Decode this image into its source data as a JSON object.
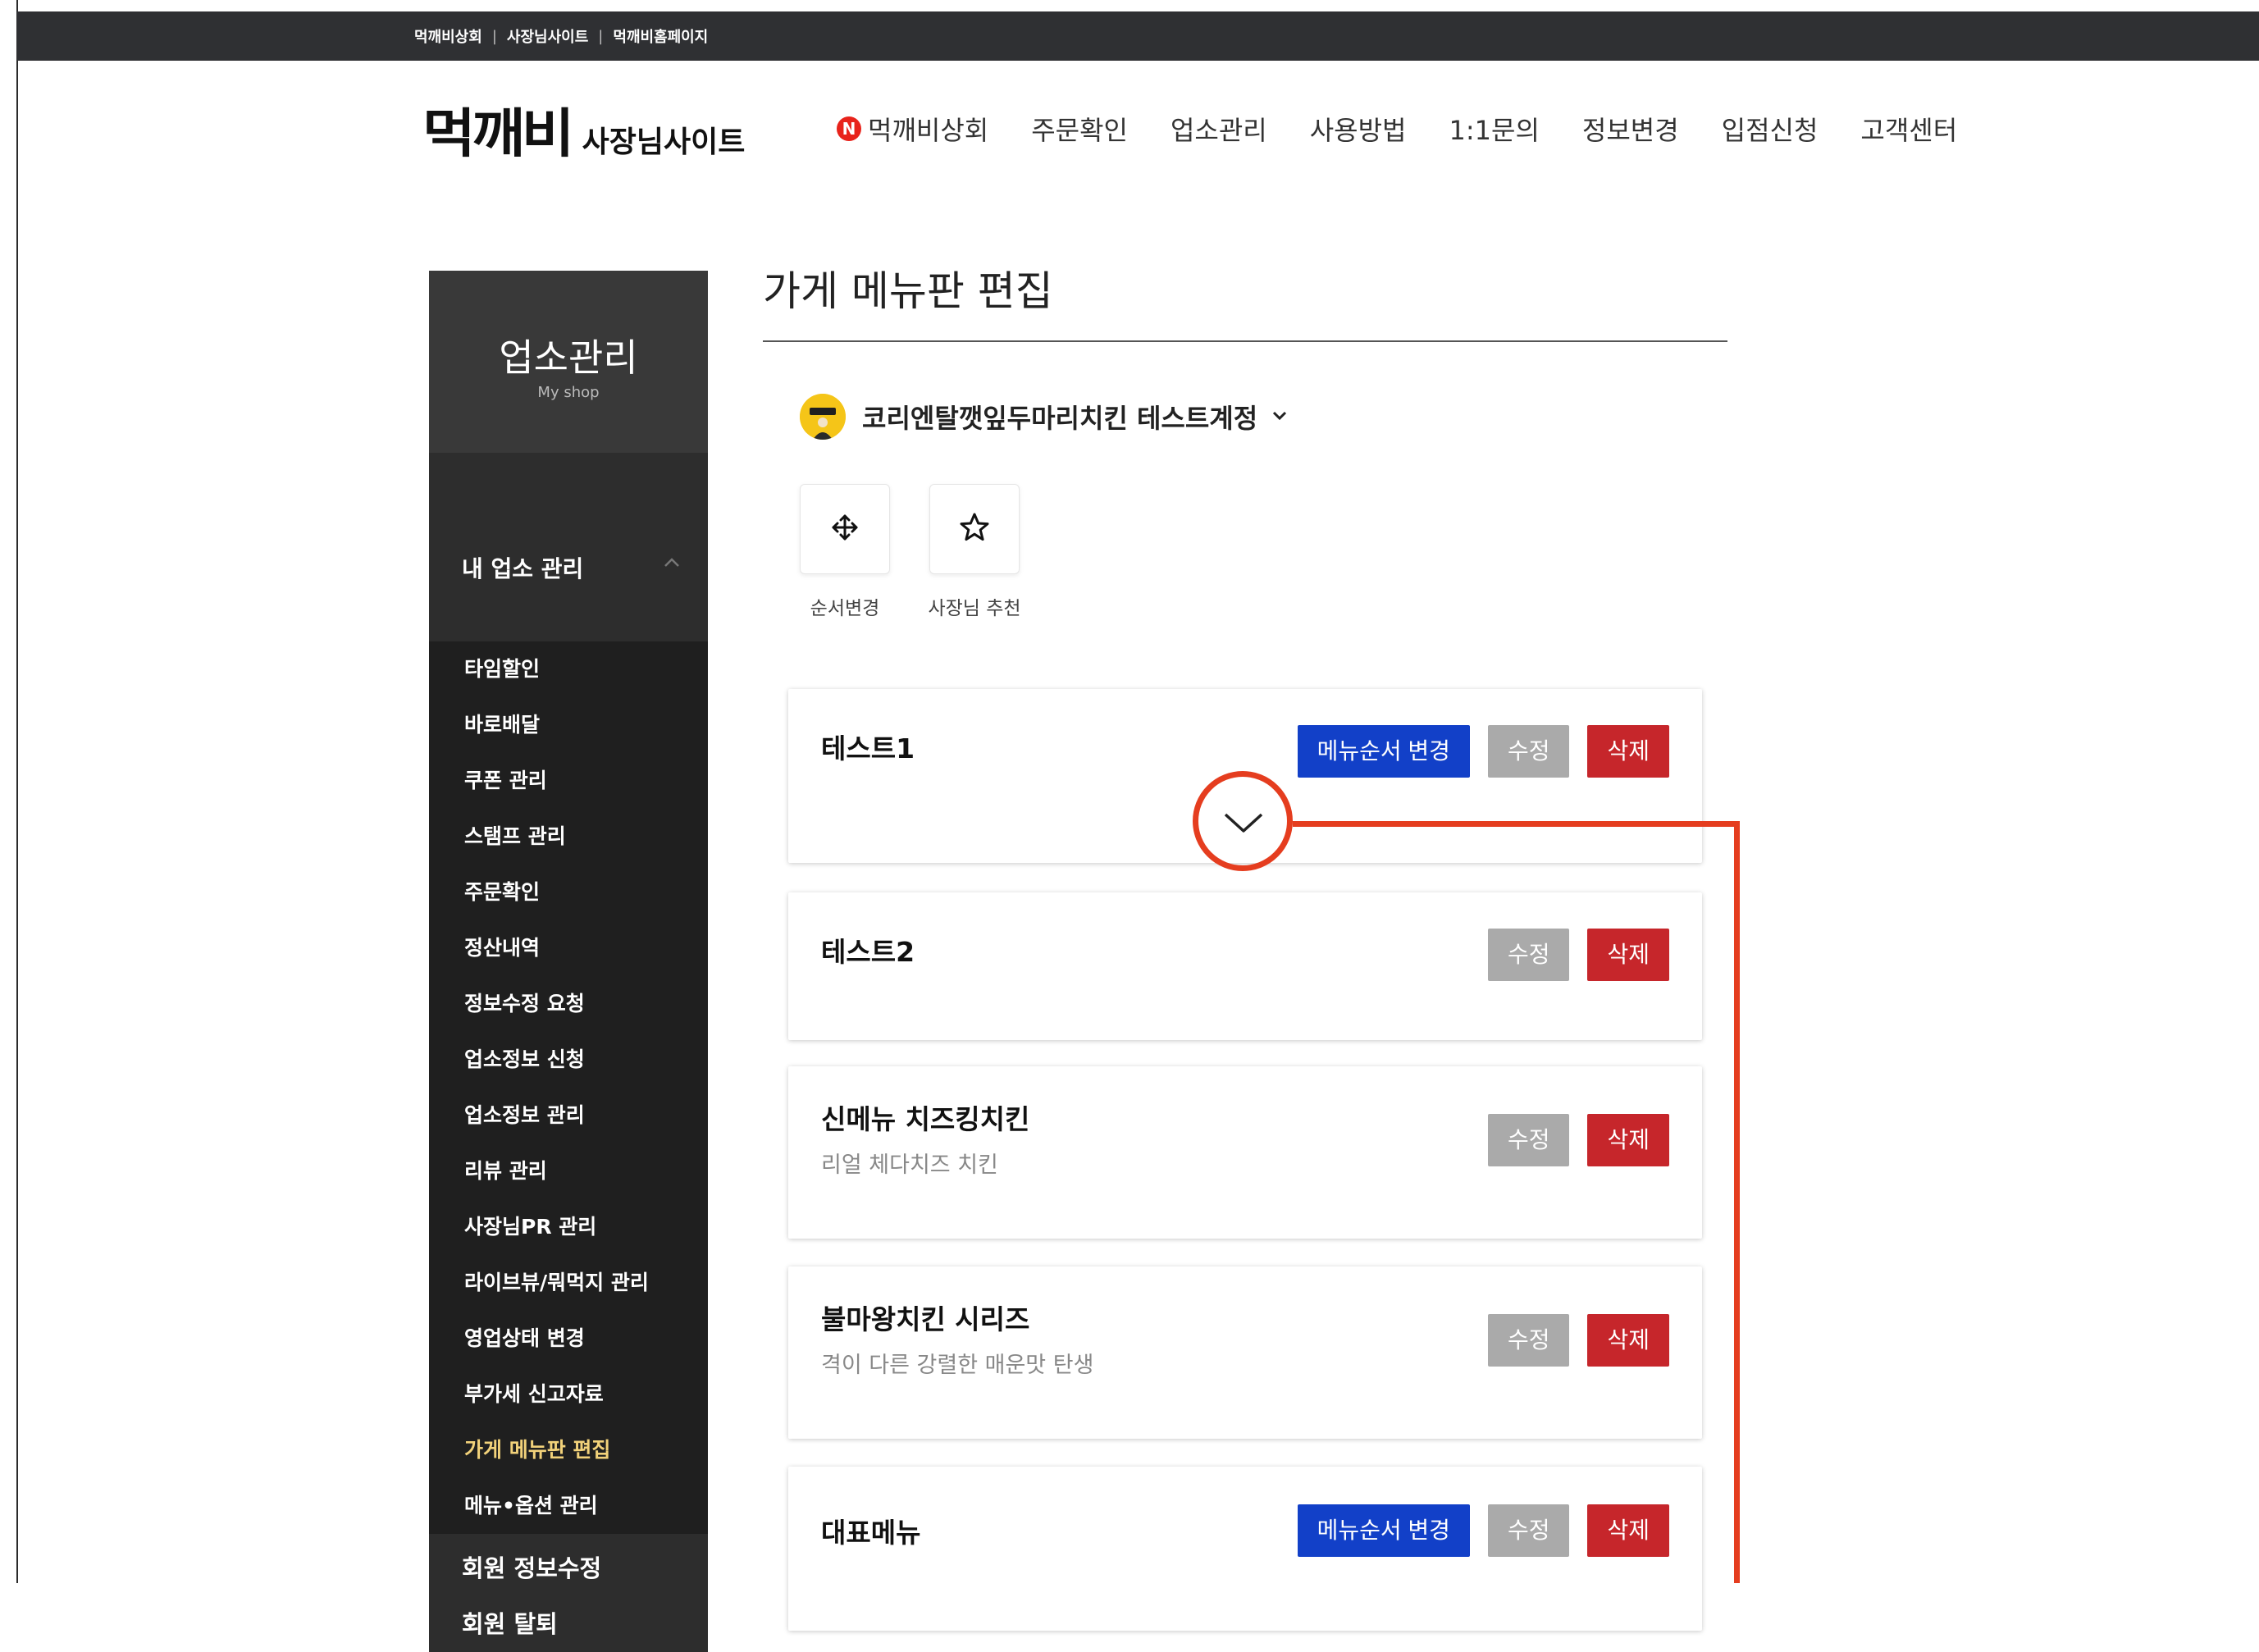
{
  "topbar": {
    "links": [
      "먹깨비상회",
      "사장님사이트",
      "먹깨비홈페이지"
    ],
    "separator": "|"
  },
  "header": {
    "logo_main": "먹깨비",
    "logo_sub": "사장님사이트",
    "nav": [
      {
        "label": "먹깨비상회",
        "badge": "N"
      },
      {
        "label": "주문확인"
      },
      {
        "label": "업소관리"
      },
      {
        "label": "사용방법"
      },
      {
        "label": "1:1문의"
      },
      {
        "label": "정보변경"
      },
      {
        "label": "입점신청"
      },
      {
        "label": "고객센터"
      }
    ]
  },
  "sidebar": {
    "title": "업소관리",
    "subtitle": "My shop",
    "section": "내 업소 관리",
    "items": [
      "타임할인",
      "바로배달",
      "쿠폰 관리",
      "스탬프 관리",
      "주문확인",
      "정산내역",
      "정보수정 요청",
      "업소정보 신청",
      "업소정보 관리",
      "리뷰 관리",
      "사장님PR 관리",
      "라이브뷰/뭐먹지 관리",
      "영업상태 변경",
      "부가세 신고자료",
      "가게 메뉴판 편집",
      "메뉴•옵션 관리"
    ],
    "active_item": "가게 메뉴판 편집",
    "bottom_items": [
      "회원 정보수정",
      "회원 탈퇴"
    ]
  },
  "main": {
    "title": "가게 메뉴판 편집",
    "store_name": "코리엔탈깻잎두마리치킨 테스트계정",
    "tools": [
      {
        "icon": "move-icon",
        "label": "순서변경"
      },
      {
        "icon": "star-icon",
        "label": "사장님 추천"
      }
    ],
    "buttons": {
      "reorder": "메뉴순서 변경",
      "edit": "수정",
      "delete": "삭제"
    },
    "cards": [
      {
        "name": "테스트1",
        "desc": "",
        "reorder": true
      },
      {
        "name": "테스트2",
        "desc": "",
        "reorder": false
      },
      {
        "name": "신메뉴 치즈킹치킨",
        "desc": "리얼 체다치즈 치킨",
        "reorder": false
      },
      {
        "name": "불마왕치킨 시리즈",
        "desc": "격이 다른 강렬한 매운맛 탄생",
        "reorder": false
      },
      {
        "name": "대표메뉴",
        "desc": "",
        "reorder": true
      }
    ]
  },
  "colors": {
    "topbar": "#2f3033",
    "sidebar": "#1f1f1f",
    "accent_blue": "#1240c8",
    "delete_red": "#c6262b",
    "edit_gray": "#aaaaaa",
    "annotation": "#e53d1f",
    "active_menu": "#f2d27a"
  }
}
